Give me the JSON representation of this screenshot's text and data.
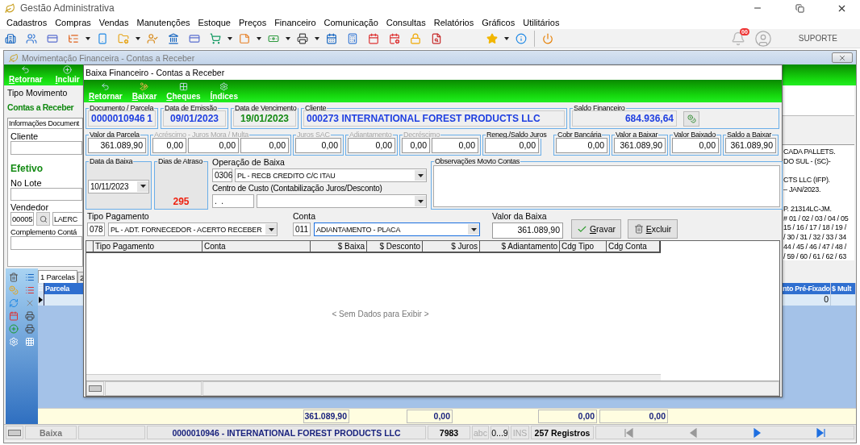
{
  "app": {
    "title": "Gestão Administrativa",
    "menu": [
      "Cadastros",
      "Compras",
      "Vendas",
      "Manutenções",
      "Estoque",
      "Preços",
      "Financeiro",
      "Comunicação",
      "Consultas",
      "Relatórios",
      "Gráficos",
      "Utilitários"
    ],
    "notification_count": "00",
    "support": "SUPORTE"
  },
  "background_window": {
    "title": "Movimentação Financeira - Contas a Receber",
    "toolbar": [
      "Retornar",
      "Incluir"
    ],
    "tipo_movimento": {
      "label": "Tipo Movimento",
      "value": "Contas a Receber"
    },
    "form_tab": "Informações Document",
    "form": {
      "cliente_label": "Cliente",
      "status": "Efetivo",
      "lote_label": "No Lote",
      "vendedor_label": "Vendedor",
      "vendedor_code": "00005",
      "vendedor_name": "LAERC",
      "complemento_label": "Complemento Contá"
    },
    "notes": [
      "CADA PALLETS.",
      "DO SUL - (SC)-",
      "CTS LLC (IFP).",
      "– JAN/2023.",
      "P. 21314LC-JM.",
      "# 01 / 02 / 03 / 04 / 05",
      "15 / 16 / 17 / 18 / 19 /",
      "/ 30 / 31 / 32 / 33 / 34",
      "44 / 45 / 46 / 47 / 48 /",
      "/ 59 / 60 / 61 / 62 / 63"
    ],
    "tabs": [
      {
        "label": "1 Parcelas",
        "selected": true
      },
      {
        "label": "2",
        "selected": false
      }
    ],
    "grid": {
      "columns": [
        {
          "label": "Parcela"
        },
        {
          "label": "nto Pré-Fixado",
          "value": "0"
        },
        {
          "label": "$ Mult"
        }
      ]
    },
    "totals": [
      "361.089,90",
      "0,00",
      "0,00",
      "0,00"
    ]
  },
  "status_bar": {
    "mode": "Baixa",
    "record": "0000010946 - INTERNATIONAL FOREST PRODUCTS LLC",
    "code": "7983",
    "indicators": [
      {
        "label": "abc",
        "on": false
      },
      {
        "label": "0...9",
        "on": true
      },
      {
        "label": "INS",
        "on": false
      }
    ],
    "count": "257 Registros",
    "nav": [
      {
        "kind": "first",
        "disabled": true
      },
      {
        "kind": "previous",
        "disabled": true
      },
      {
        "kind": "next",
        "disabled": false
      },
      {
        "kind": "last",
        "disabled": false
      }
    ]
  },
  "dialog": {
    "title": "Baixa Financeiro - Contas a Receber",
    "toolbar": [
      "Retornar",
      "Baixar",
      "Cheques",
      "Índices"
    ],
    "header": [
      {
        "label": "Documento / Parcela",
        "kind": "document",
        "values": [
          "0000010946",
          "1"
        ]
      },
      {
        "label": "Data de Emissão",
        "kind": "date",
        "values": [
          "09/01/2023"
        ]
      },
      {
        "label": "Data de Vencimento",
        "kind": "due",
        "values": [
          "19/01/2023"
        ]
      },
      {
        "label": "Cliente",
        "kind": "client",
        "values": [
          "000273 INTERNATIONAL FOREST PRODUCTS LLC"
        ]
      },
      {
        "label": "Saldo Financeiro",
        "kind": "balance",
        "values": [
          "684.936,64"
        ]
      }
    ],
    "amounts": [
      {
        "label": "Valor da Parcela",
        "disabled": false,
        "values": [
          "361.089,90"
        ]
      },
      {
        "label": "Acréscimo - Juros Mora / Multa",
        "disabled": true,
        "values": [
          "0,00",
          "0,00",
          "0,00"
        ]
      },
      {
        "label": "Juros SAC",
        "disabled": true,
        "values": [
          "0,00"
        ]
      },
      {
        "label": "Adiantamento",
        "disabled": true,
        "values": [
          "0,00"
        ]
      },
      {
        "label": "Decréscimo",
        "disabled": true,
        "values": [
          "0,00",
          "0,00"
        ]
      },
      {
        "label": "Reneg./Saldo Juros",
        "disabled": false,
        "values": [
          "0,00"
        ]
      },
      {
        "label": "Cobr Bancária",
        "disabled": false,
        "values": [
          "0,00"
        ]
      },
      {
        "label": "Valor a Baixar",
        "disabled": false,
        "values": [
          "361.089,90"
        ]
      },
      {
        "label": "Valor Baixado",
        "disabled": false,
        "values": [
          "0,00"
        ]
      },
      {
        "label": "Saldo a Baixar",
        "disabled": false,
        "values": [
          "361.089,90"
        ]
      }
    ],
    "data_baixa": {
      "label": "Data da Baixa",
      "value": "10/11/2023"
    },
    "dias_atraso": {
      "label": "Dias de Atraso",
      "value": "295"
    },
    "operacao": {
      "label": "Operação de Baixa",
      "code": "0306",
      "value": "PL - RECB CREDITO C/C ITAU"
    },
    "centro_custo": {
      "label": "Centro de Custo (Contabilização Juros/Desconto)",
      "code": ".  ."
    },
    "observacoes": {
      "label": "Observações Movto Contas"
    },
    "tipo_pagamento": {
      "label": "Tipo Pagamento",
      "code": "078",
      "value": "PL - ADT. FORNECEDOR - ACERTO RECEBER",
      "focused": false
    },
    "conta": {
      "label": "Conta",
      "code": "011",
      "value": "ADIANTAMENTO - PLACA",
      "focused": true
    },
    "valor_baixa": {
      "label": "Valor da Baixa",
      "value": "361.089,90"
    },
    "actions": [
      {
        "label": "Gravar",
        "kind": "save"
      },
      {
        "label": "Excluir",
        "kind": "delete"
      }
    ],
    "grid": {
      "columns": [
        "Tipo Pagamento",
        "Conta",
        "$ Baixa",
        "$ Desconto",
        "$ Juros",
        "$ Adiantamento",
        "Cdg Tipo",
        "Cdg Conta"
      ],
      "empty_message": "< Sem Dados para Exibir >"
    }
  }
}
